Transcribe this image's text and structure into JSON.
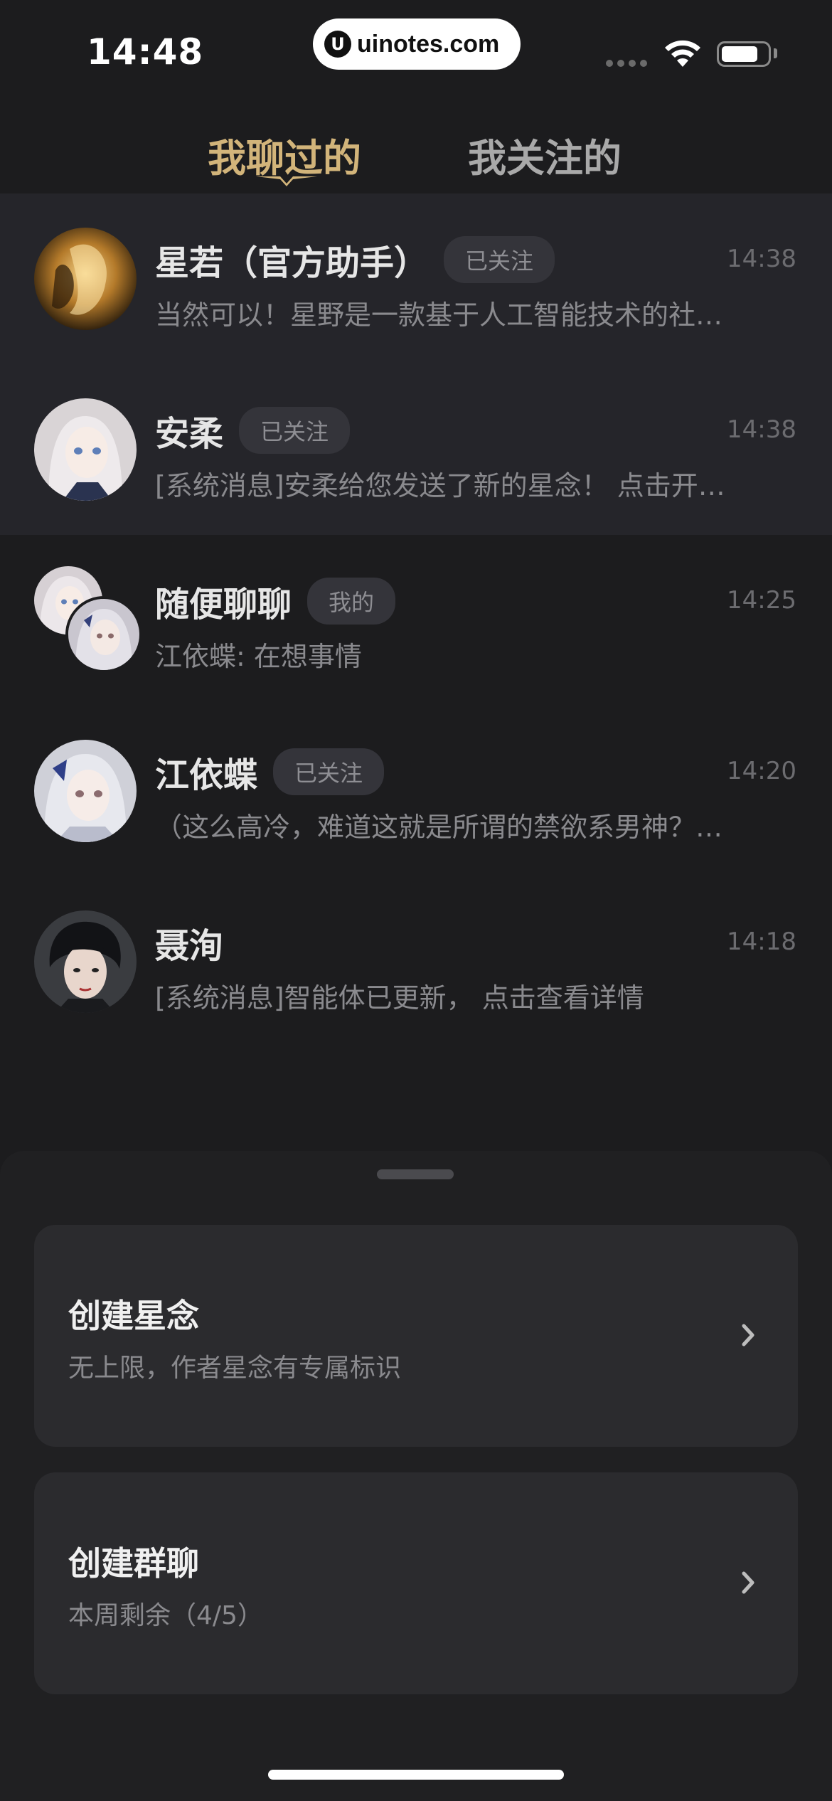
{
  "status_bar": {
    "time": "14:48",
    "watermark": "uinotes.com",
    "battery_level": 0.8
  },
  "tabs": [
    {
      "label": "我聊过的",
      "active": true
    },
    {
      "label": "我关注的",
      "active": false
    }
  ],
  "chats": [
    {
      "name": "星若（官方助手）",
      "badge": "已关注",
      "time": "14:38",
      "preview": "当然可以！星野是一款基于人工智能技术的社…",
      "pinned": true
    },
    {
      "name": "安柔",
      "badge": "已关注",
      "time": "14:38",
      "preview": "[系统消息]安柔给您发送了新的星念！ 点击开…",
      "pinned": true
    },
    {
      "name": "随便聊聊",
      "badge": "我的",
      "time": "14:25",
      "preview": "江依蝶: 在想事情",
      "pinned": false,
      "group": true
    },
    {
      "name": "江依蝶",
      "badge": "已关注",
      "time": "14:20",
      "preview": "（这么高冷，难道这就是所谓的禁欲系男神？…",
      "pinned": false
    },
    {
      "name": "聂洵",
      "badge": "",
      "time": "14:18",
      "preview": "[系统消息]智能体已更新， 点击查看详情",
      "pinned": false
    }
  ],
  "sheet": {
    "actions": [
      {
        "title": "创建星念",
        "subtitle": "无上限，作者星念有专属标识"
      },
      {
        "title": "创建群聊",
        "subtitle": "本周剩余（4/5）"
      }
    ]
  },
  "colors": {
    "accent": "#d2b47a",
    "background": "#1c1c1e",
    "pinned_row": "#25252a",
    "card": "#2b2b2e"
  }
}
